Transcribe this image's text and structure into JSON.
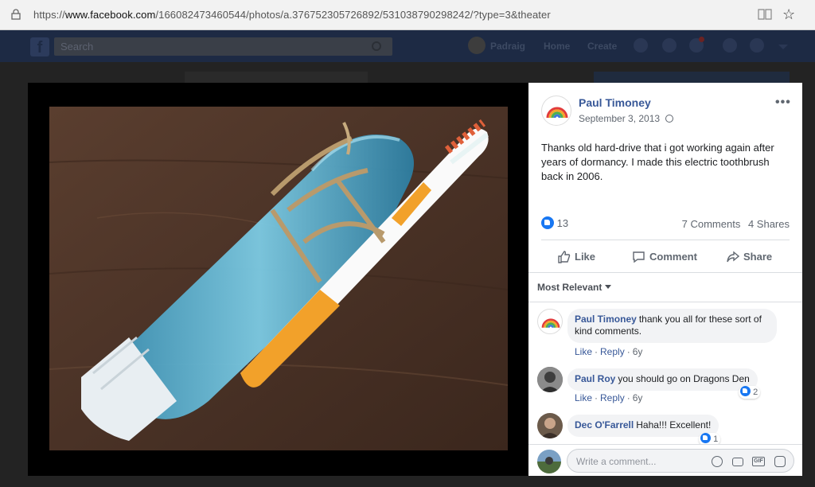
{
  "browser": {
    "url_prefix": "https://",
    "url_domain": "www.facebook.com",
    "url_path": "/166082473460544/photos/a.376752305726892/531038790298242/?type=3&theater"
  },
  "fb_header": {
    "search_placeholder": "Search",
    "profile_name": "Padraig",
    "home": "Home",
    "create": "Create"
  },
  "post": {
    "author": "Paul Timoney",
    "date": "September 3, 2013",
    "text": "Thanks old hard-drive that i got working again after years of dormancy. I made this electric toothbrush back in 2006.",
    "like_count": "13",
    "comments_count": "7 Comments",
    "shares_count": "4 Shares",
    "actions": {
      "like": "Like",
      "comment": "Comment",
      "share": "Share"
    },
    "sort_label": "Most Relevant"
  },
  "comments": [
    {
      "name": "Paul Timoney",
      "text": "thank you all for these sort of kind comments.",
      "like": "Like",
      "reply": "Reply",
      "age": "6y",
      "reactions": ""
    },
    {
      "name": "Paul Roy",
      "text": "you should go on Dragons Den",
      "like": "Like",
      "reply": "Reply",
      "age": "6y",
      "reactions": "2"
    },
    {
      "name": "Dec O'Farrell",
      "text": "Haha!!! Excellent!",
      "like": "",
      "reply": "",
      "age": "",
      "reactions": "1"
    }
  ],
  "composer": {
    "placeholder": "Write a comment..."
  },
  "colors": {
    "fb_blue": "#385898",
    "like_blue": "#1877f2",
    "theater_bg": "#000000"
  }
}
